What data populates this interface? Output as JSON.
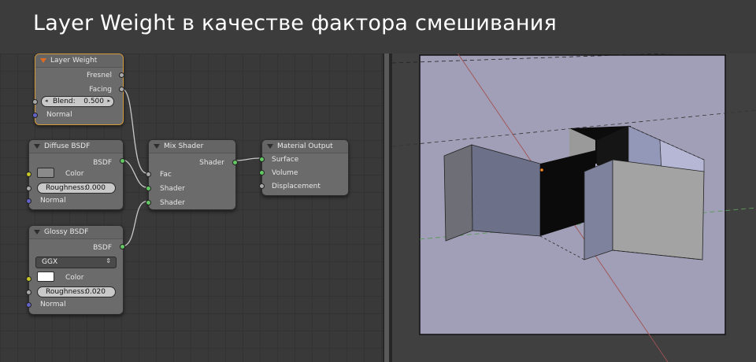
{
  "title": "Layer Weight в качестве фактора смешивания",
  "colors": {
    "socket_float": "#a8a8a8",
    "socket_shader": "#63c763",
    "socket_color": "#c7c729",
    "socket_vector": "#6363c7",
    "selected_outline": "#d49a3c"
  },
  "nodes": {
    "layer_weight": {
      "header": "Layer Weight",
      "outputs": [
        "Fresnel",
        "Facing"
      ],
      "blend_label": "Blend:",
      "blend_value": "0.500",
      "normal_label": "Normal"
    },
    "diffuse": {
      "header": "Diffuse BSDF",
      "output": "BSDF",
      "color_label": "Color",
      "color_value": "#888888",
      "roughness_label": "Roughness:",
      "roughness_value": "0.000",
      "normal_label": "Normal"
    },
    "glossy": {
      "header": "Glossy BSDF",
      "output": "BSDF",
      "distribution": "GGX",
      "color_label": "Color",
      "color_value": "#ffffff",
      "roughness_label": "Roughness:",
      "roughness_value": "0.020",
      "normal_label": "Normal"
    },
    "mix": {
      "header": "Mix Shader",
      "output": "Shader",
      "inputs": [
        "Fac",
        "Shader",
        "Shader"
      ]
    },
    "output": {
      "header": "Material Output",
      "inputs": [
        "Surface",
        "Volume",
        "Displacement"
      ]
    }
  }
}
